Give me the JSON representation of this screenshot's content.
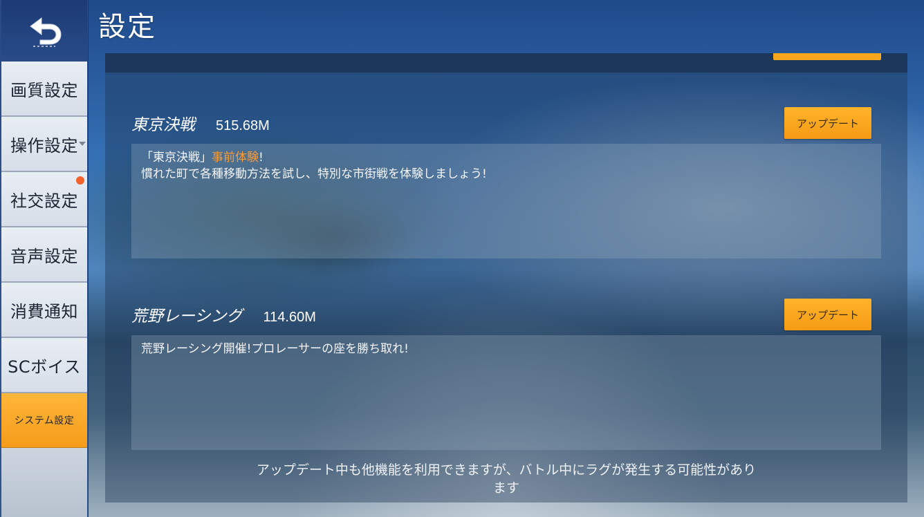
{
  "header": {
    "title": "設定"
  },
  "sidebar": {
    "back_icon": "undo-arrow-icon",
    "items": [
      {
        "label": "画質設定"
      },
      {
        "label": "操作設定",
        "has_dropdown": true
      },
      {
        "label": "社交設定",
        "notification_dot": true
      },
      {
        "label": "音声設定"
      },
      {
        "label": "消費通知"
      },
      {
        "label": "SCボイス"
      },
      {
        "label": "システム設定",
        "active": true
      }
    ]
  },
  "downloads": [
    {
      "name": "東京決戦",
      "size": "515.68M",
      "button_label": "アップデート",
      "desc_prefix": "「東京決戦」",
      "desc_highlight": "事前体験",
      "desc_suffix": "!",
      "desc_line2": "慣れた町で各種移動方法を試し、特別な市街戦を体験しましょう!"
    },
    {
      "name": "荒野レーシング",
      "size": "114.60M",
      "button_label": "アップデート",
      "desc_line1": "荒野レーシング開催!プロレーサーの座を勝ち取れ!"
    }
  ],
  "footer": {
    "note": "アップデート中も他機能を利用できますが、バトル中にラグが発生する可能性があります"
  },
  "colors": {
    "accent_orange": "#f9a61c",
    "highlight_text": "#ff9a2e",
    "notification_dot": "#f2632e"
  }
}
